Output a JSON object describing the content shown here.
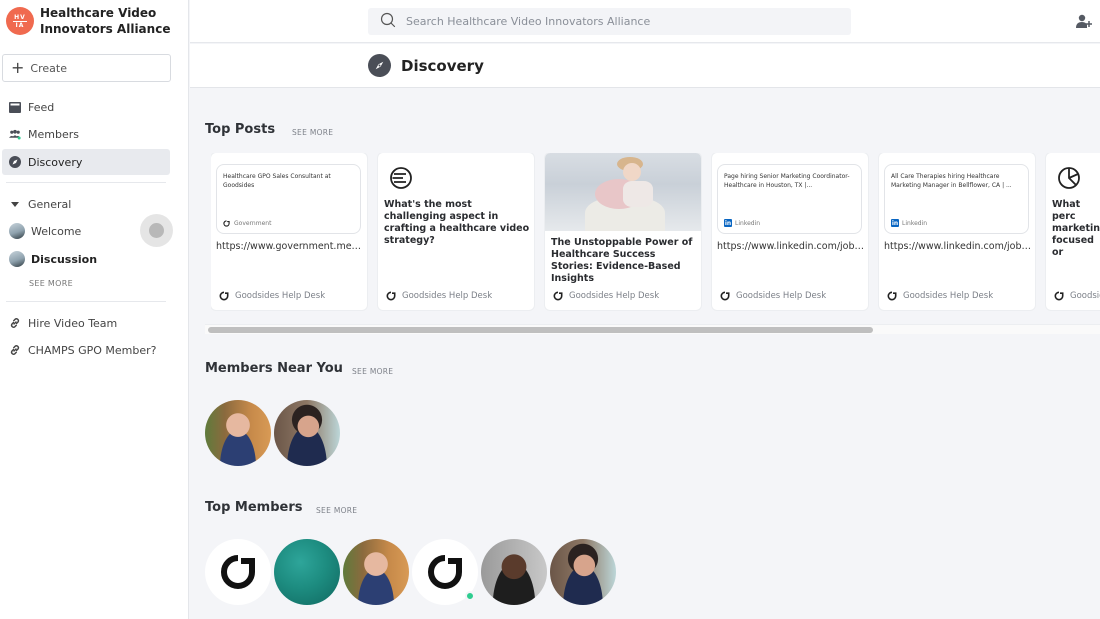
{
  "brand": {
    "logo_text_top": "HV",
    "logo_text_bottom": "IA",
    "name_line1": "Healthcare Video",
    "name_line2": "Innovators Alliance",
    "accent_color": "#f06a4f"
  },
  "search": {
    "placeholder": "Search Healthcare Video Innovators Alliance",
    "value": ""
  },
  "sidebar": {
    "create_label": "Create",
    "nav": [
      {
        "label": "Feed",
        "icon": "feed-icon"
      },
      {
        "label": "Members",
        "icon": "members-icon"
      },
      {
        "label": "Discovery",
        "icon": "compass-icon",
        "active": true
      }
    ],
    "group_label": "General",
    "channels": [
      {
        "label": "Welcome",
        "bold": false
      },
      {
        "label": "Discussion",
        "bold": true
      }
    ],
    "see_more": "SEE MORE",
    "links": [
      {
        "label": "Hire Video Team",
        "icon": "link-icon"
      },
      {
        "label": "CHAMPS GPO Member?",
        "icon": "link-icon"
      }
    ]
  },
  "page": {
    "title": "Discovery"
  },
  "top_posts": {
    "title": "Top Posts",
    "see_more": "SEE MORE",
    "cards": [
      {
        "type": "link",
        "preview_title": "Healthcare GPO Sales Consultant at Goodsides",
        "preview_source": "Government",
        "url": "https://www.government.medi...",
        "author": "Goodsides Help Desk"
      },
      {
        "type": "question",
        "icon": "poll-lines-icon",
        "text": "What's the most challenging aspect in crafting a healthcare video strategy?",
        "author": "Goodsides Help Desk"
      },
      {
        "type": "article",
        "title": "The Unstoppable Power of Healthcare Success Stories: Evidence-Based Insights",
        "author": "Goodsides Help Desk"
      },
      {
        "type": "link",
        "preview_title": "Page hiring Senior Marketing Coordinator-Healthcare in Houston, TX |...",
        "preview_source": "Linkedin",
        "url": "https://www.linkedin.com/jobs/...",
        "author": "Goodsides Help Desk"
      },
      {
        "type": "link",
        "preview_title": "All Care Therapies hiring Healthcare Marketing Manager in Bellflower, CA | ...",
        "preview_source": "Linkedin",
        "url": "https://www.linkedin.com/jobs/...",
        "author": "Goodsides Help Desk"
      },
      {
        "type": "question",
        "icon": "pie-chart-icon",
        "text": "What perc marketing focused or",
        "author": "Goodsid"
      }
    ]
  },
  "members_near_you": {
    "title": "Members Near You",
    "see_more": "SEE MORE",
    "members": [
      {
        "name": "member-man-glasses"
      },
      {
        "name": "member-woman-embroidered"
      }
    ]
  },
  "top_members": {
    "title": "Top Members",
    "see_more": "SEE MORE",
    "members": [
      {
        "name": "goodsides-logo-1"
      },
      {
        "name": "teal-avatar"
      },
      {
        "name": "member-man-glasses"
      },
      {
        "name": "goodsides-logo-2",
        "online": true
      },
      {
        "name": "member-smiling-man"
      },
      {
        "name": "member-woman-embroidered"
      }
    ],
    "online_color": "#2ecc8f"
  }
}
